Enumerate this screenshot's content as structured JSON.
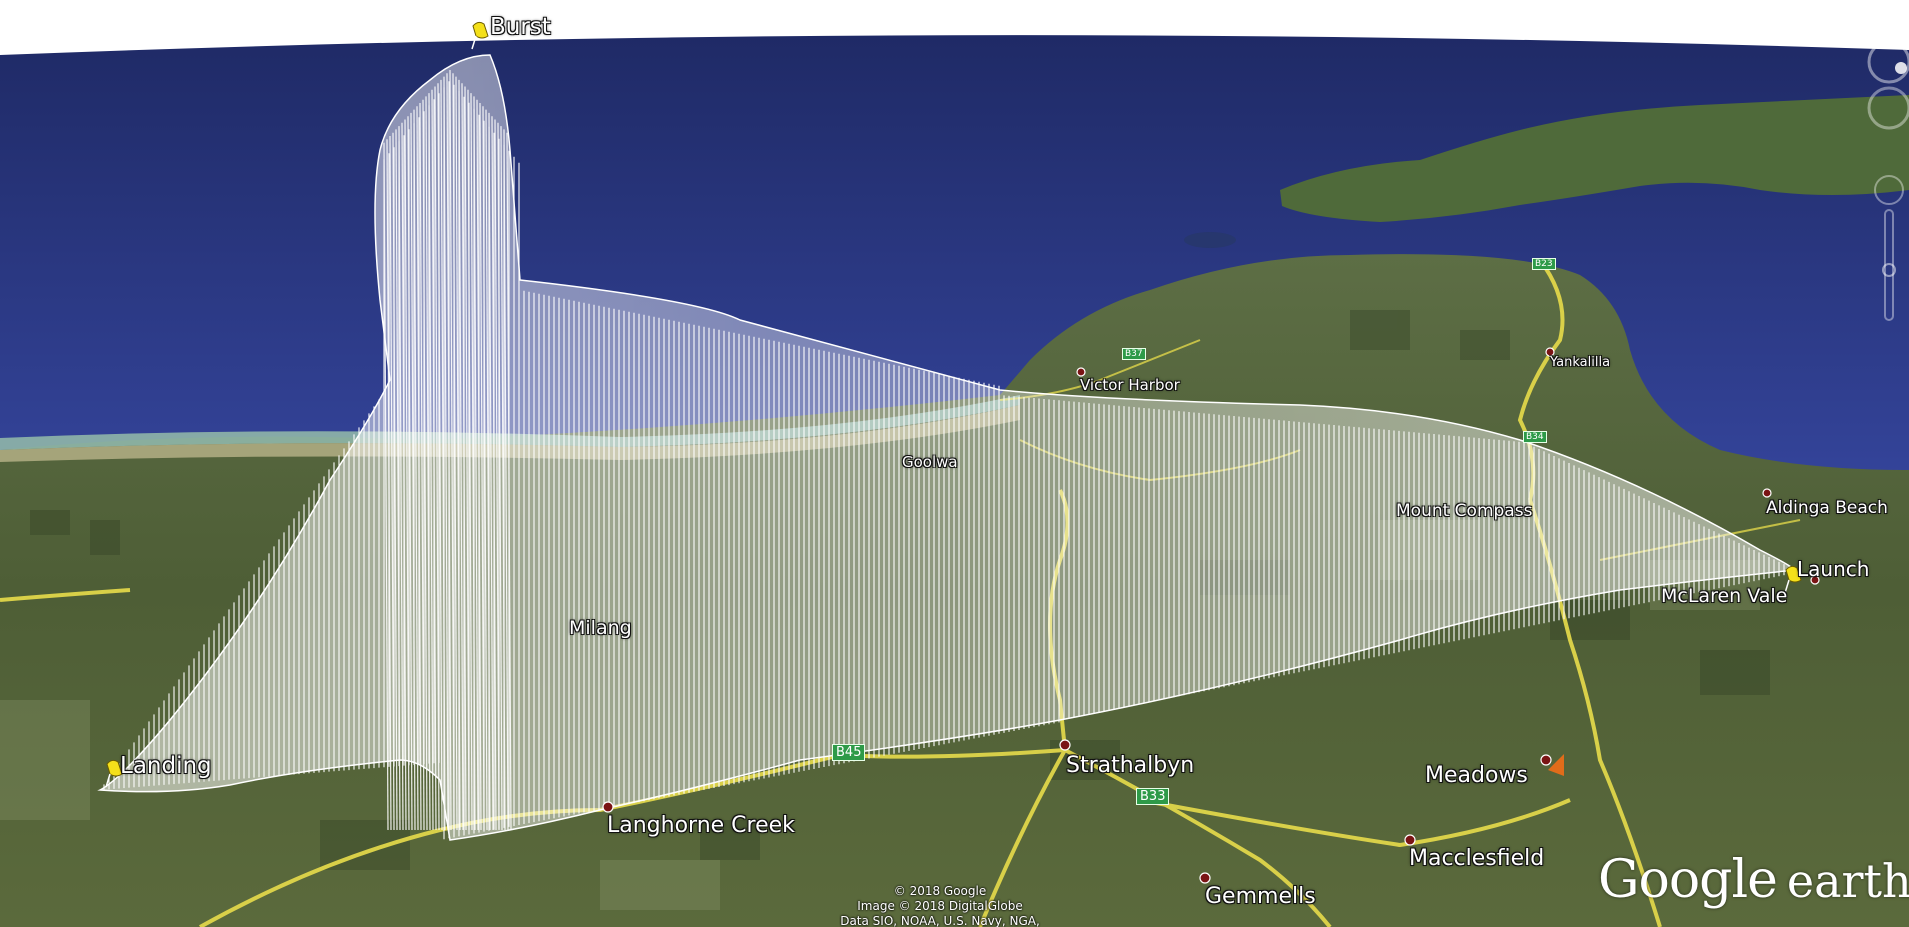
{
  "app": {
    "logo_text_1": "Google",
    "logo_text_2": "earth"
  },
  "pins": [
    {
      "name": "burst",
      "label": "Burst"
    },
    {
      "name": "landing",
      "label": "Landing"
    },
    {
      "name": "launch",
      "label": "Launch"
    }
  ],
  "towns": [
    {
      "name": "victor-harbor",
      "label": "Victor Harbor"
    },
    {
      "name": "yankalilla",
      "label": "Yankalilla"
    },
    {
      "name": "goolwa",
      "label": "Goolwa"
    },
    {
      "name": "mount-compass",
      "label": "Mount Compass"
    },
    {
      "name": "aldinga-beach",
      "label": "Aldinga Beach"
    },
    {
      "name": "mclaren-vale",
      "label": "McLaren Vale"
    },
    {
      "name": "milang",
      "label": "Milang"
    },
    {
      "name": "strathalbyn",
      "label": "Strathalbyn"
    },
    {
      "name": "meadows",
      "label": "Meadows"
    },
    {
      "name": "langhorne-creek",
      "label": "Langhorne Creek"
    },
    {
      "name": "macclesfield",
      "label": "Macclesfield"
    },
    {
      "name": "gemmells",
      "label": "Gemmells"
    }
  ],
  "road_shields": [
    {
      "name": "b45",
      "label": "B45"
    },
    {
      "name": "b33",
      "label": "B33"
    },
    {
      "name": "b34",
      "label": "B34"
    },
    {
      "name": "b37",
      "label": "B37"
    },
    {
      "name": "b23",
      "label": "B23"
    }
  ],
  "credits": {
    "line1": "© 2018 Google",
    "line2": "Image © 2018 DigitalGlobe",
    "line3": "Data SIO, NOAA, U.S. Navy, NGA, GEBCO"
  },
  "colors": {
    "sea": "#2e3d88",
    "land": "#4a5a32",
    "road": "#e0d64a",
    "track": "#ffffff",
    "pin": "#f4e01a",
    "shield": "#2e9a48"
  }
}
